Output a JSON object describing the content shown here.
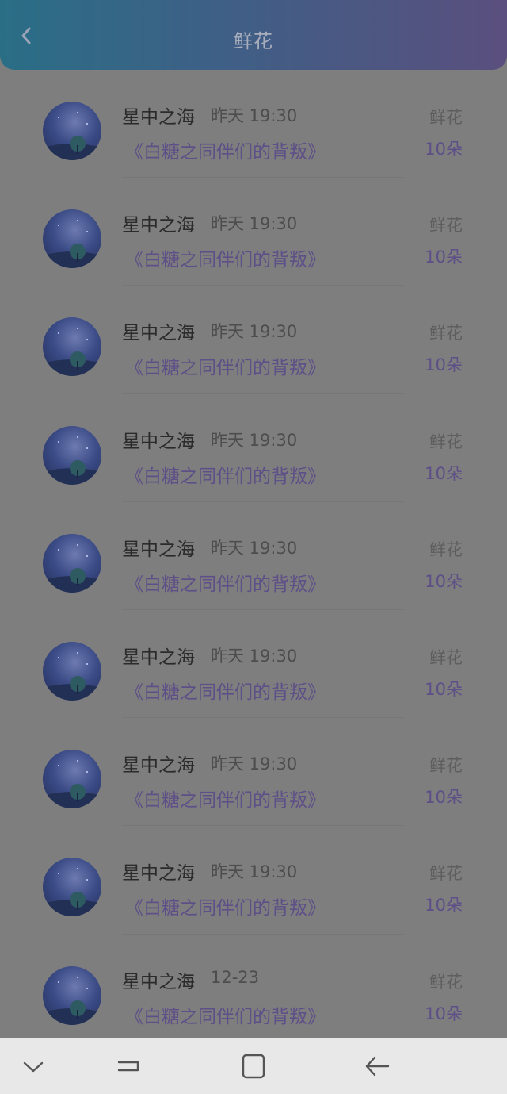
{
  "header": {
    "title": "鲜花",
    "back_icon": "chevron-left-icon",
    "gradient": [
      "#2a6e86",
      "#5a4f7e"
    ]
  },
  "items": [
    {
      "name": "星中之海",
      "time": "昨天 19:30",
      "book": "《白糖之同伴们的背叛》",
      "type": "鲜花",
      "count": "10朵"
    },
    {
      "name": "星中之海",
      "time": "昨天 19:30",
      "book": "《白糖之同伴们的背叛》",
      "type": "鲜花",
      "count": "10朵"
    },
    {
      "name": "星中之海",
      "time": "昨天 19:30",
      "book": "《白糖之同伴们的背叛》",
      "type": "鲜花",
      "count": "10朵"
    },
    {
      "name": "星中之海",
      "time": "昨天 19:30",
      "book": "《白糖之同伴们的背叛》",
      "type": "鲜花",
      "count": "10朵"
    },
    {
      "name": "星中之海",
      "time": "昨天 19:30",
      "book": "《白糖之同伴们的背叛》",
      "type": "鲜花",
      "count": "10朵"
    },
    {
      "name": "星中之海",
      "time": "昨天 19:30",
      "book": "《白糖之同伴们的背叛》",
      "type": "鲜花",
      "count": "10朵"
    },
    {
      "name": "星中之海",
      "time": "昨天 19:30",
      "book": "《白糖之同伴们的背叛》",
      "type": "鲜花",
      "count": "10朵"
    },
    {
      "name": "星中之海",
      "time": "昨天 19:30",
      "book": "《白糖之同伴们的背叛》",
      "type": "鲜花",
      "count": "10朵"
    },
    {
      "name": "星中之海",
      "time": "12-23",
      "book": "《白糖之同伴们的背叛》",
      "type": "鲜花",
      "count": "10朵"
    }
  ],
  "navbar": {
    "icons": [
      "chevron-down-icon",
      "recent-apps-icon",
      "home-icon",
      "back-arrow-icon"
    ]
  }
}
